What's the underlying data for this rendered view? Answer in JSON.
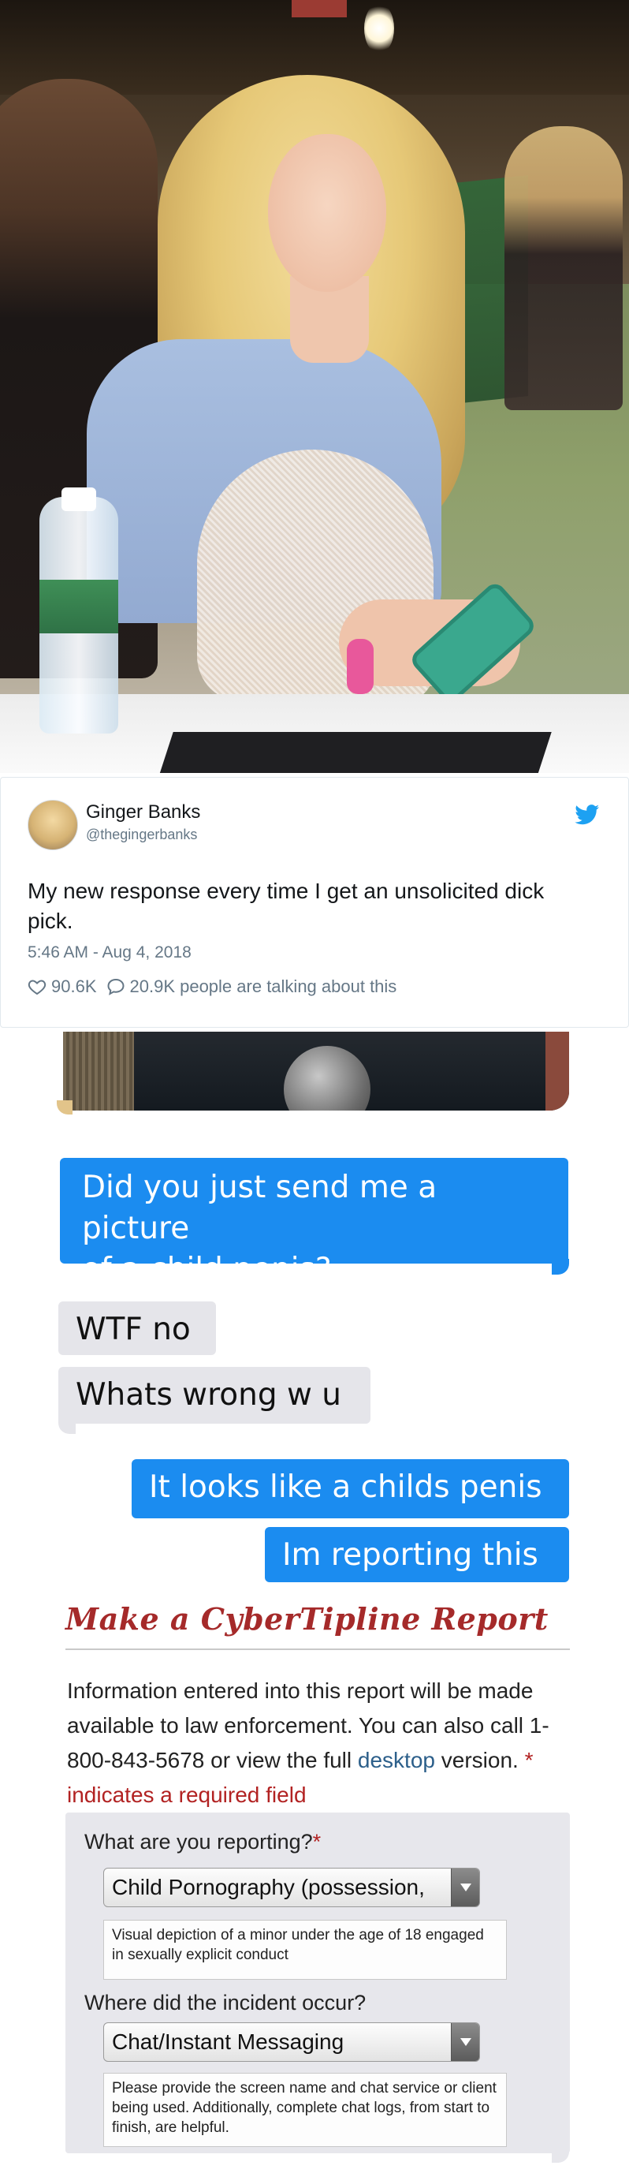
{
  "tweet": {
    "name": "Ginger Banks",
    "handle": "@thegingerbanks",
    "text": "My new response every time I get an unsolicited dick pick.",
    "timestamp": "5:46 AM - Aug 4, 2018",
    "likes": "90.6K",
    "replies": "20.9K people are talking about this",
    "brand_color": "#1da1f2"
  },
  "messages": [
    {
      "from": "me",
      "text_lines": [
        "Did you just send me a picture",
        "of a child penis?"
      ]
    },
    {
      "from": "them",
      "text": "WTF no"
    },
    {
      "from": "them",
      "text": "Whats wrong w u"
    },
    {
      "from": "me",
      "text": "It looks like a childs penis"
    },
    {
      "from": "me",
      "text": "Im reporting this"
    }
  ],
  "colors": {
    "sent_bubble": "#1b8cf0",
    "received_bubble": "#e5e5ea",
    "form_title": "#a52a2a"
  },
  "report_form": {
    "title": "Make a CyberTipline Report",
    "intro_part1": "Information entered into this report will be made available to law enforcement. You can also call 1-800-843-5678 or view the full ",
    "intro_link": "desktop",
    "intro_part2": " version. ",
    "intro_required": "* indicates a required field",
    "q1_label": "What are you reporting?",
    "q1_star": "*",
    "q1_selected": "Child Pornography (possession,",
    "q1_hint": "Visual depiction of a minor under the age of 18 engaged in sexually explicit conduct",
    "q2_label": "Where did the incident occur?",
    "q2_selected": "Chat/Instant Messaging",
    "q2_hint": "Please provide the screen name and chat service or client being used. Additionally, complete chat logs, from start to finish, are helpful."
  },
  "icons": [
    "twitter-bird-icon",
    "heart-icon",
    "comment-icon",
    "dropdown-arrow-icon"
  ]
}
